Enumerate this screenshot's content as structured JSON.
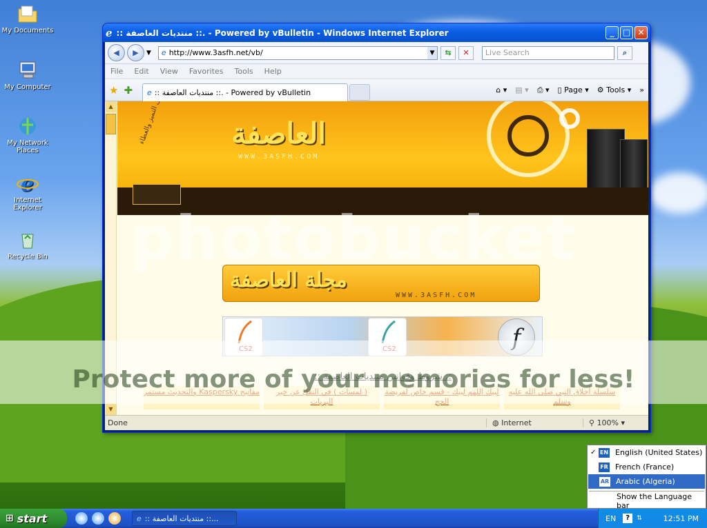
{
  "desktop": {
    "icons": [
      {
        "label": "My Documents",
        "icon": "folder-icon"
      },
      {
        "label": "My Computer",
        "icon": "computer-icon"
      },
      {
        "label": "My Network Places",
        "icon": "network-icon"
      },
      {
        "label": "Internet Explorer",
        "icon": "ie-icon"
      },
      {
        "label": "Recycle Bin",
        "icon": "recycle-bin-icon"
      }
    ]
  },
  "window": {
    "title": ":: منتديات العاصفة ::. - Powered by vBulletin - Windows Internet Explorer",
    "address": "http://www.3asfh.net/vb/",
    "search_placeholder": "Live Search",
    "menu": [
      "File",
      "Edit",
      "View",
      "Favorites",
      "Tools",
      "Help"
    ],
    "tab_title": ":: منتديات العاصفة ::. - Powered by vBulletin",
    "commands": {
      "page": "Page",
      "tools": "Tools"
    },
    "status": {
      "text": "Done",
      "zone": "Internet",
      "zoom": "100%"
    }
  },
  "page": {
    "banner_logo": "العاصفة",
    "banner_www": "WWW.3ASFH.COM",
    "banner_slogan": "ملتقى التميز والعطاء",
    "magazine_title": "مجلة العاصفة",
    "magazine_www": "WWW.3ASFH.COM",
    "cs2_label": "CS2",
    "rules_heading": ":: شروط وقوانين منتديات العاصفة ::",
    "links": [
      "سلسلة أخلاق النبي صلى الله عليه وسلم",
      "لبيك اللهم لبيك - قسم خاص لفريضة الحج",
      "( لمسات ) في النقل عن خير البريات",
      "مفاتيح Kaspersky والتحديث مستمر"
    ]
  },
  "watermark": {
    "brand": "photobucket",
    "slogan": "Protect more of your memories for less!"
  },
  "language_menu": {
    "items": [
      {
        "code": "EN",
        "label": "English (United States)",
        "checked": true
      },
      {
        "code": "FR",
        "label": "French (France)",
        "checked": false
      },
      {
        "code": "AR",
        "label": "Arabic (Algeria)",
        "checked": false
      }
    ],
    "show_bar": "Show the Language bar"
  },
  "taskbar": {
    "start": "start",
    "task_label": ":: منتديات العاصفة ::...",
    "lang": "EN",
    "clock": "12:51 PM"
  },
  "colors": {
    "titlebar": "#0a5ee0",
    "banner": "#ffc41d",
    "taskbar": "#245edb",
    "start": "#2f8c2f",
    "selection": "#316ac5"
  }
}
